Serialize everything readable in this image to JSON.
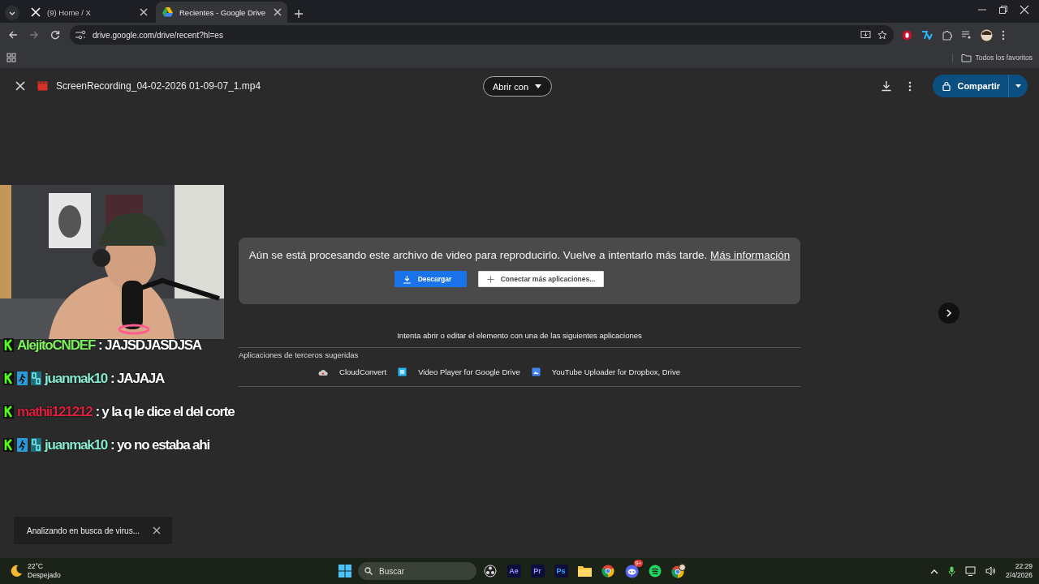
{
  "browser": {
    "tabs": [
      {
        "title": "(9) Home / X",
        "kind": "x",
        "selected": false
      },
      {
        "title": "Recientes - Google Drive",
        "kind": "drive",
        "selected": true
      }
    ],
    "url": "drive.google.com/drive/recent?hl=es",
    "bookmarks": [
      "Todos los favoritos"
    ]
  },
  "viewer": {
    "file_name": "ScreenRecording_04-02-2026 01-09-07_1.mp4",
    "open_with": "Abrir con",
    "share": "Compartir",
    "message": "Aún se está procesando este archivo de video para reproducirlo. Vuelve a intentarlo más tarde.",
    "message_link": "Más información",
    "buttons": [
      {
        "label": "Descargar",
        "kind": "primary"
      },
      {
        "label": "Conectar más aplicaciones...",
        "kind": "secondary"
      }
    ],
    "apps_hint": "Intenta abrir o editar el elemento con una de las siguientes aplicaciones",
    "apps_heading": "Aplicaciones de terceros sugeridas",
    "apps": [
      {
        "name": "CloudConvert",
        "kind": "cloud"
      },
      {
        "name": "Video Player for Google Drive",
        "kind": "player"
      },
      {
        "name": "YouTube Uploader for Dropbox, Drive",
        "kind": "uploader"
      }
    ]
  },
  "stream_overlay": {
    "chat": [
      {
        "user": "AlejitoCNDEF",
        "color": "#7ef25a",
        "text": ": JAJSDJASDJSA",
        "extra_badges": false
      },
      {
        "user": "juanmak10",
        "color": "#86e8cf",
        "text": ": JAJAJA",
        "extra_badges": true
      },
      {
        "user": "mathii121212",
        "color": "#d8203f",
        "text": ": y la q le dice el del corte",
        "extra_badges": false
      },
      {
        "user": "juanmak10",
        "color": "#86e8cf",
        "text": ": yo no estaba ahi",
        "extra_badges": true
      }
    ]
  },
  "toast": "Analizando en busca de virus...",
  "taskbar": {
    "weather": {
      "temp": "22°C",
      "condition": "Despejado"
    },
    "search_placeholder": "Buscar",
    "apps": [
      {
        "kind": "obs"
      },
      {
        "kind": "letter",
        "label": "Ae"
      },
      {
        "kind": "letter",
        "label": "Pr"
      },
      {
        "kind": "letter",
        "label": "Ps"
      },
      {
        "kind": "folder"
      },
      {
        "kind": "chrome"
      },
      {
        "kind": "discord",
        "badge": "9+"
      },
      {
        "kind": "spotify"
      },
      {
        "kind": "chrome-profile"
      }
    ],
    "time": "22:29",
    "date": "2/4/2026"
  }
}
